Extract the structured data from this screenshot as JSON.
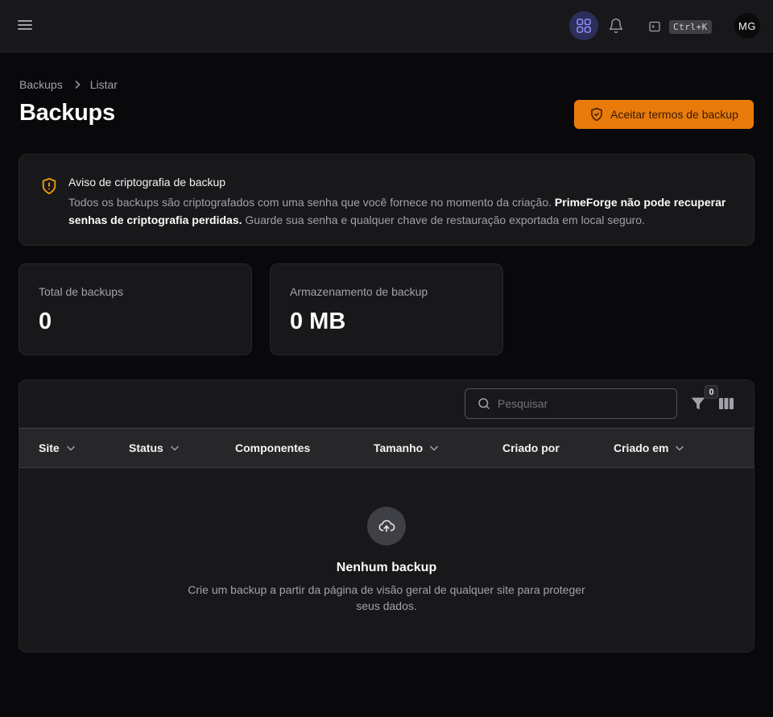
{
  "topbar": {
    "menu_icon": "menu-icon",
    "apps_icon": "grid-icon",
    "bell_icon": "bell-icon",
    "terminal_icon": "terminal-icon",
    "shortcut": "Ctrl+K",
    "avatar_initials": "MG",
    "accent": "#2e2e5c"
  },
  "breadcrumb": {
    "items": [
      "Backups",
      "Listar"
    ]
  },
  "page": {
    "title": "Backups",
    "accept_button": "Aceitar termos de backup",
    "accent_color": "#e87b0c"
  },
  "notice": {
    "icon": "shield-alert-icon",
    "title": "Aviso de criptografia de backup",
    "body_before": "Todos os backups são criptografados com uma senha que você fornece no momento da criação. ",
    "body_bold": "PrimeForge não pode recuperar senhas de criptografia perdidas.",
    "body_after": " Guarde sua senha e qualquer chave de restauração exportada em local seguro."
  },
  "stats": [
    {
      "label": "Total de backups",
      "value": "0"
    },
    {
      "label": "Armazenamento de backup",
      "value": "0 MB"
    }
  ],
  "table": {
    "search_placeholder": "Pesquisar",
    "filter_count": "0",
    "columns": [
      {
        "label": "Site",
        "sortable": true
      },
      {
        "label": "Status",
        "sortable": true
      },
      {
        "label": "Componentes",
        "sortable": false
      },
      {
        "label": "Tamanho",
        "sortable": true
      },
      {
        "label": "Criado por",
        "sortable": false
      },
      {
        "label": "Criado em",
        "sortable": true
      }
    ],
    "empty": {
      "icon": "cloud-upload-icon",
      "title": "Nenhum backup",
      "description": "Crie um backup a partir da página de visão geral de qualquer site para proteger seus dados."
    }
  }
}
